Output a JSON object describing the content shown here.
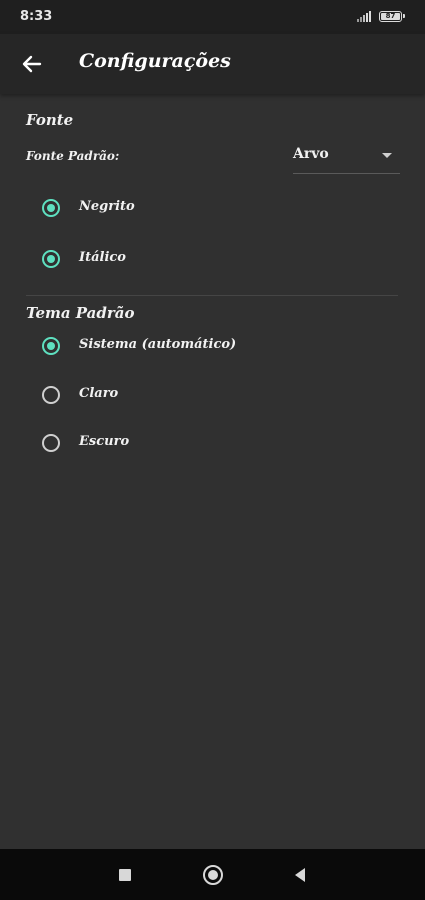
{
  "status_bar": {
    "time": "8:33",
    "battery": "87"
  },
  "app_bar": {
    "title": "Configurações"
  },
  "font_section": {
    "title": "Fonte",
    "default_font_label": "Fonte Padrão:",
    "default_font_value": "Arvo",
    "options": [
      {
        "label": "Negrito",
        "checked": true
      },
      {
        "label": "Itálico",
        "checked": true
      }
    ]
  },
  "theme_section": {
    "title": "Tema Padrão",
    "options": [
      {
        "label": "Sistema (automático)",
        "selected": true
      },
      {
        "label": "Claro",
        "selected": false
      },
      {
        "label": "Escuro",
        "selected": false
      }
    ]
  },
  "colors": {
    "accent": "#5ee0c0",
    "background": "#303030",
    "app_bar": "#262626"
  },
  "icons": {
    "back": "arrow-back-icon",
    "nav_recents": "square-icon",
    "nav_home": "circle-icon",
    "nav_back": "triangle-back-icon"
  }
}
